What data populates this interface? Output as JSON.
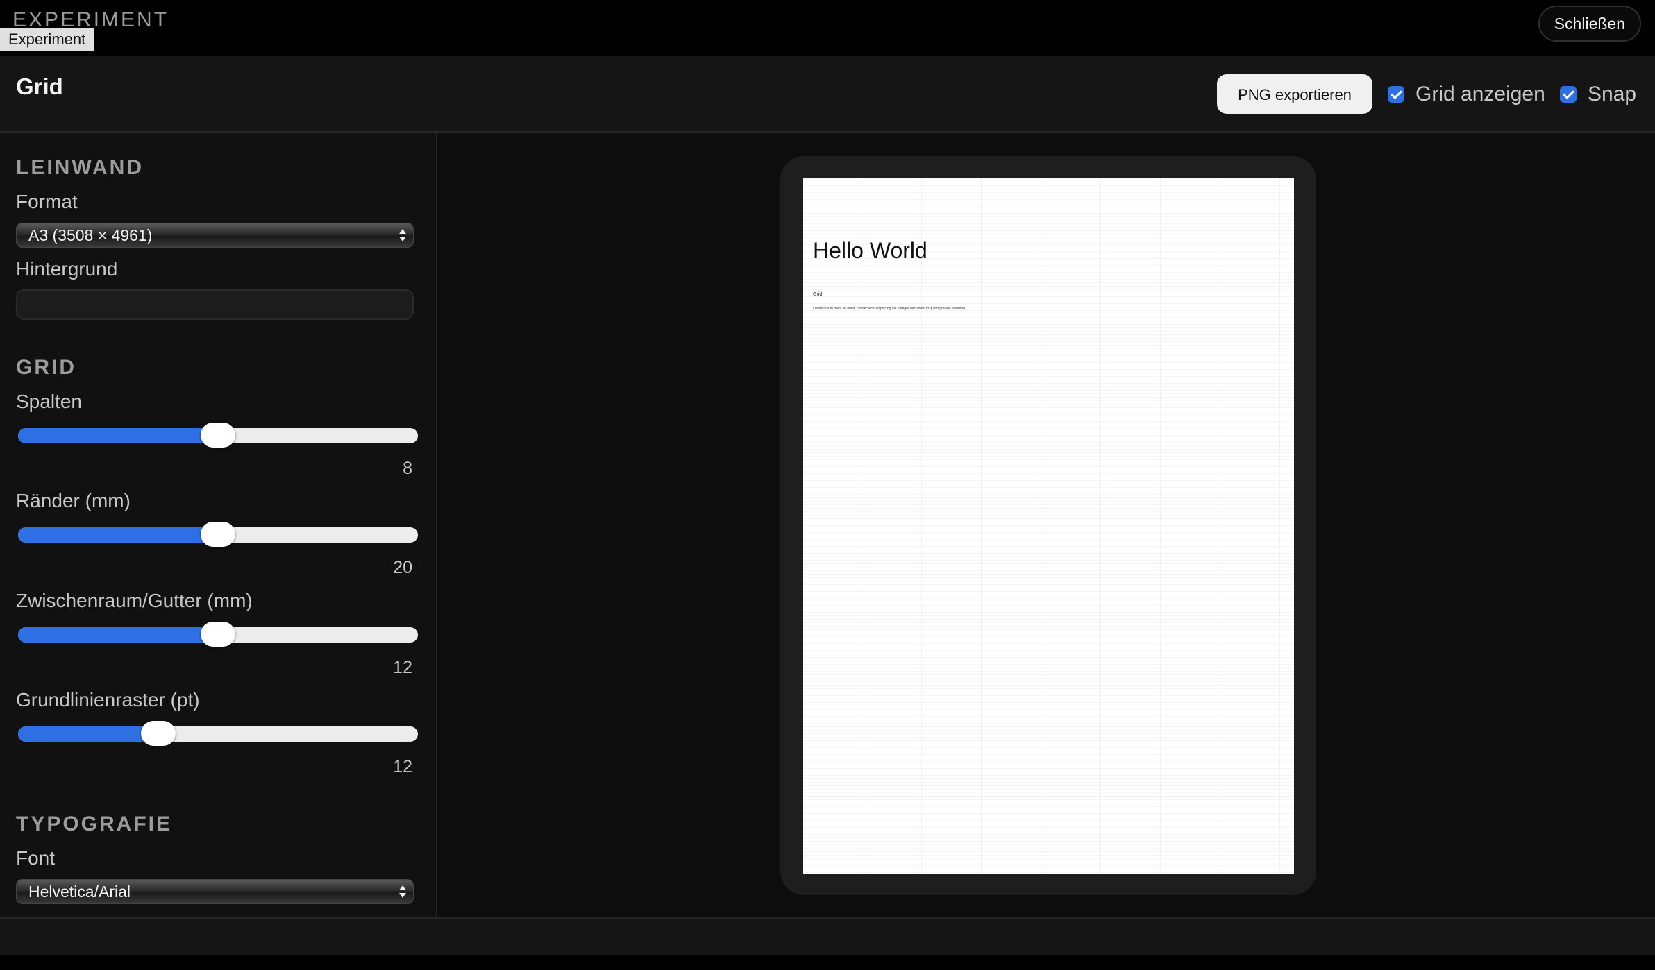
{
  "app": {
    "title": "EXPERIMENT",
    "tag": "Experiment",
    "close_label": "Schließen"
  },
  "header": {
    "title": "Grid",
    "export_label": "PNG exportieren",
    "show_grid": {
      "label": "Grid anzeigen",
      "checked": true
    },
    "snap": {
      "label": "Snap",
      "checked": true
    }
  },
  "sidebar": {
    "canvas_section": {
      "heading": "LEINWAND",
      "format_label": "Format",
      "format_value": "A3 (3508 × 4961)",
      "background_label": "Hintergrund"
    },
    "grid_section": {
      "heading": "GRID",
      "columns": {
        "label": "Spalten",
        "value": "8",
        "fraction": 0.5
      },
      "margins": {
        "label": "Ränder (mm)",
        "value": "20",
        "fraction": 0.5
      },
      "gutter": {
        "label": "Zwischenraum/Gutter (mm)",
        "value": "12",
        "fraction": 0.5
      },
      "baseline": {
        "label": "Grundlinienraster (pt)",
        "value": "12",
        "fraction": 0.35
      }
    },
    "typography_section": {
      "heading": "TYPOGRAFIE",
      "font_label": "Font",
      "font_value": "Helvetica/Arial"
    }
  },
  "canvas": {
    "heading": "Hello World",
    "small_label": "Grid",
    "body_text": "Lorem ipsum dolor sit amet, consectetur adipiscing elit. Integer nec libero id quam gravida euismod."
  },
  "colors": {
    "accent": "#2f6fe4",
    "background": "#0d0d0d",
    "paper": "#ffffff"
  }
}
